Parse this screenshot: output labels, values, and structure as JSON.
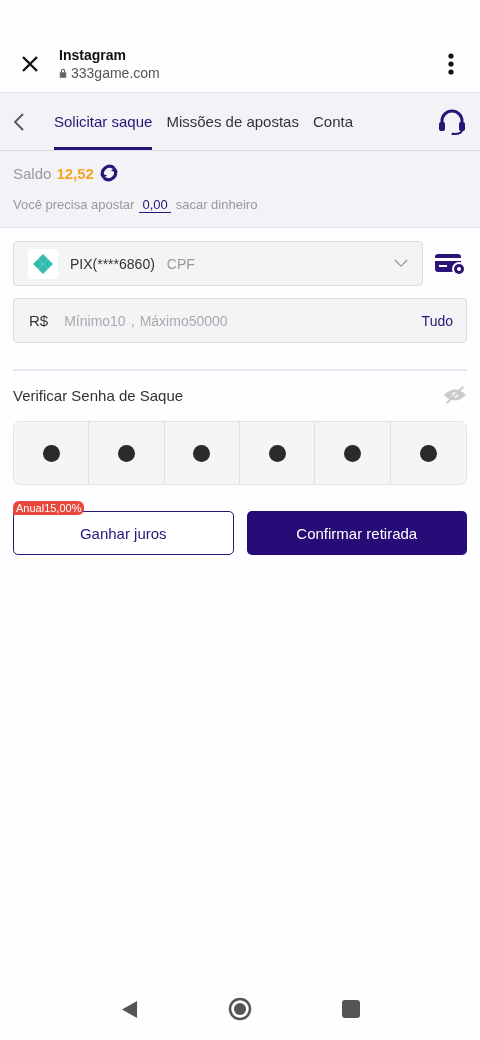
{
  "browser_bar": {
    "title": "Instagram",
    "url": "333game.com"
  },
  "tabs": [
    {
      "label": "Solicitar saque",
      "selected": true
    },
    {
      "label": "Missões de apostas",
      "selected": false
    },
    {
      "label": "Conta",
      "selected": false
    }
  ],
  "balance": {
    "label": "Saldo",
    "value": "12,52"
  },
  "bet_notice": {
    "before": "Você precisa apostar",
    "amount": "0,00",
    "after": "sacar dinheiro"
  },
  "account_select": {
    "value": "PIX(****6860)",
    "type": "CPF"
  },
  "amount_field": {
    "currency": "R$",
    "placeholder": "Mínimo10，Máximo50000",
    "all_button": "Tudo"
  },
  "password": {
    "label": "Verificar Senha de Saque",
    "visible": false,
    "digits": [
      {
        "filled": true
      },
      {
        "filled": true
      },
      {
        "filled": true
      },
      {
        "filled": true
      },
      {
        "filled": true
      },
      {
        "filled": true
      }
    ]
  },
  "buttons": {
    "interest": "Ganhar juros",
    "interest_badge": "Anual15,00%",
    "confirm": "Confirmar retirada"
  }
}
